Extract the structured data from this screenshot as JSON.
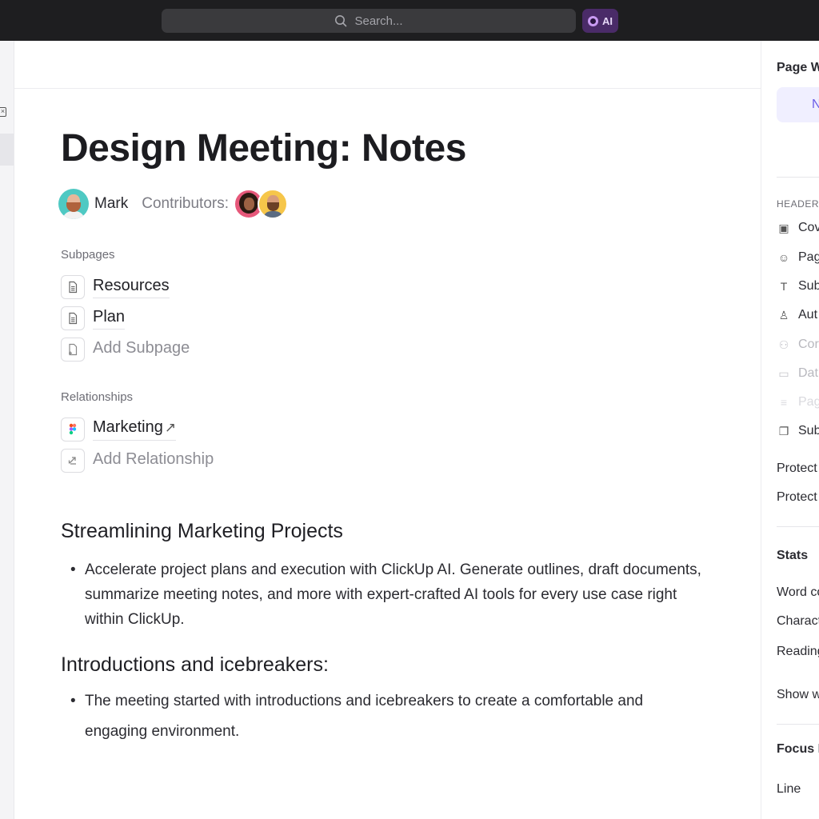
{
  "topbar": {
    "search_placeholder": "Search...",
    "ai_label": "AI"
  },
  "doc": {
    "title": "Design Meeting: Notes",
    "author": "Mark",
    "contributors_label": "Contributors:",
    "subpages_label": "Subpages",
    "subpages": [
      "Resources",
      "Plan"
    ],
    "add_subpage": "Add Subpage",
    "relationships_label": "Relationships",
    "relationships": [
      "Marketing"
    ],
    "add_relationship": "Add Relationship",
    "sections": [
      {
        "heading": "Streamlining Marketing Projects",
        "bullets": [
          "Accelerate project plans and execution with ClickUp AI. Generate outlines, draft documents, summarize meeting notes, and more with expert-crafted AI tools for every use case right within ClickUp."
        ]
      },
      {
        "heading": "Introductions and icebreakers:",
        "bullets": [
          "The meeting started with introductions and icebreakers to create a comfortable and engaging environment."
        ]
      }
    ]
  },
  "right_panel": {
    "title": "Page W",
    "box_text": "N",
    "header_section": "HEADER",
    "header_items": [
      "Cov",
      "Pag",
      "Sub",
      "Aut",
      "Cor",
      "Dat",
      "Pag",
      "Sub"
    ],
    "protect_1": "Protect",
    "protect_2": "Protect",
    "stats_title": "Stats",
    "stats": [
      "Word co",
      "Charact",
      "Reading"
    ],
    "show_more": "Show w",
    "focus_title": "Focus M",
    "focus_item": "Line"
  },
  "colors": {
    "accent": "#6b5ce7",
    "topbar": "#1e1e20"
  }
}
